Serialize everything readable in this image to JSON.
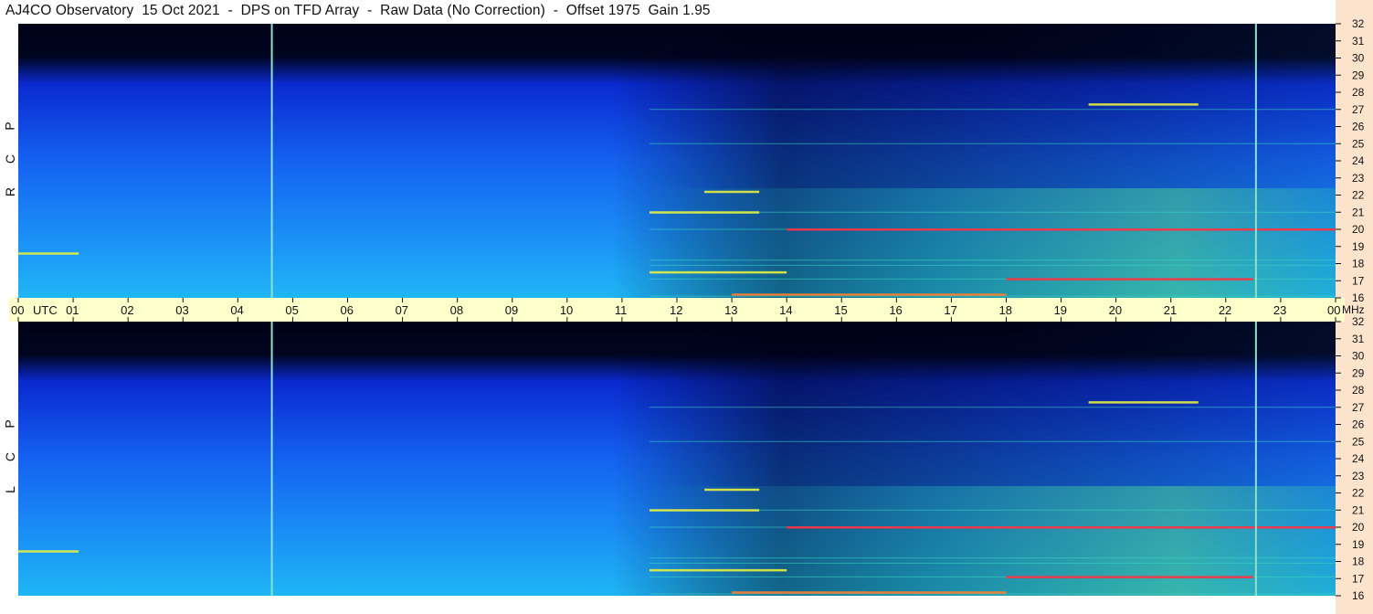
{
  "header": {
    "title": "AJ4CO Observatory  15 Oct 2021  -  DPS on TFD Array  -  Raw Data (No Correction)  -  Offset 1975  Gain 1.95"
  },
  "panels": {
    "rcp_label": [
      "R",
      "C",
      "P"
    ],
    "lcp_label": [
      "L",
      "C",
      "P"
    ]
  },
  "colors": {
    "background_low": "#000218",
    "mid_blue": "#1462f0",
    "light_cyan": "#1fb6f6",
    "emission_yellow": "#e6f040",
    "emission_red": "#ff3040",
    "utc_bar": "#ffffcc",
    "freq_strip": "#fbe3cc"
  },
  "chart_data": {
    "type": "heatmap",
    "title": "AJ4CO Observatory  15 Oct 2021  -  DPS on TFD Array  -  Raw Data (No Correction)  -  Offset 1975  Gain 1.95",
    "x_axis": {
      "label_unit": "UTC",
      "range": [
        0,
        24
      ],
      "tick_labels": [
        "00",
        "01",
        "02",
        "03",
        "04",
        "05",
        "06",
        "07",
        "08",
        "09",
        "10",
        "11",
        "12",
        "13",
        "14",
        "15",
        "16",
        "17",
        "18",
        "19",
        "20",
        "21",
        "22",
        "23",
        "00"
      ]
    },
    "y_axis": {
      "label_unit": "MHz",
      "range": [
        16,
        32
      ],
      "tick_labels": [
        "16",
        "17",
        "18",
        "19",
        "20",
        "21",
        "22",
        "23",
        "24",
        "25",
        "26",
        "27",
        "28",
        "29",
        "30",
        "31",
        "32"
      ]
    },
    "panels": [
      "RCP",
      "LCP"
    ],
    "marker_lines_utc": [
      4.62,
      22.55
    ],
    "horizontal_interference_mhz": [
      16.1,
      17.1,
      17.9,
      18.2,
      20.0,
      21.0,
      25.0,
      27.0
    ],
    "emission_bursts": [
      {
        "utc": [
          11.5,
          14.0
        ],
        "mhz": 17.5,
        "color": "#e6f040"
      },
      {
        "utc": [
          13.0,
          18.0
        ],
        "mhz": 16.2,
        "color": "#ff8030"
      },
      {
        "utc": [
          18.0,
          22.5
        ],
        "mhz": 17.1,
        "color": "#ff3040"
      },
      {
        "utc": [
          14.0,
          24.0
        ],
        "mhz": 20.0,
        "color": "#ff3040"
      },
      {
        "utc": [
          19.5,
          21.5
        ],
        "mhz": 27.3,
        "color": "#e6f040"
      },
      {
        "utc": [
          12.5,
          13.5
        ],
        "mhz": 22.2,
        "color": "#e6f040"
      },
      {
        "utc": [
          0.0,
          1.1
        ],
        "mhz": 18.6,
        "color": "#e6f040"
      },
      {
        "utc": [
          11.5,
          13.5
        ],
        "mhz": 21.0,
        "color": "#e6f040"
      }
    ]
  }
}
